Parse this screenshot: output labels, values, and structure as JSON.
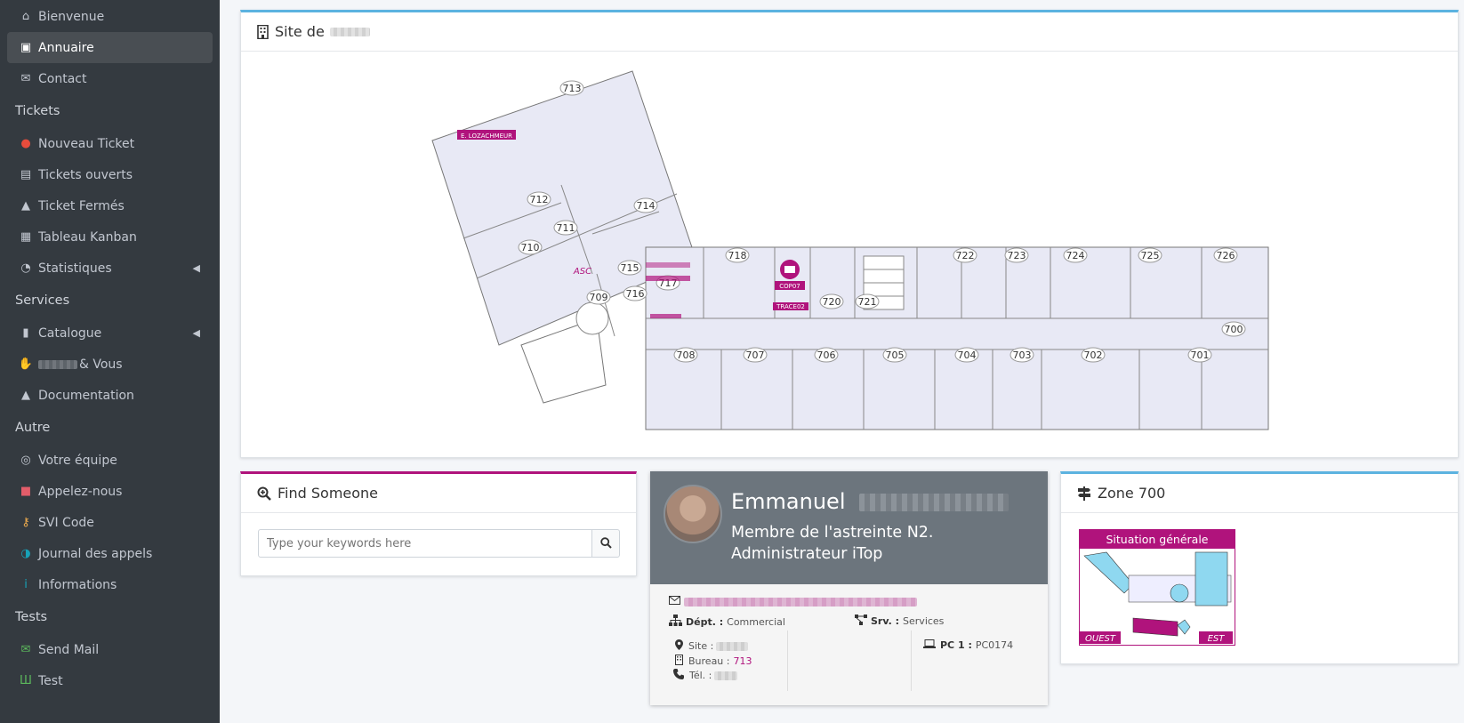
{
  "sidebar": {
    "items": [
      {
        "type": "item",
        "label": "Bienvenue",
        "icon": "home-icon"
      },
      {
        "type": "item",
        "label": "Annuaire",
        "icon": "address-card-icon",
        "active": true
      },
      {
        "type": "item",
        "label": "Contact",
        "icon": "envelope-icon"
      },
      {
        "type": "header",
        "label": "Tickets"
      },
      {
        "type": "item",
        "label": "Nouveau Ticket",
        "icon": "exclamation-circle-icon"
      },
      {
        "type": "item",
        "label": "Tickets ouverts",
        "icon": "clipboard-icon"
      },
      {
        "type": "item",
        "label": "Ticket Fermés",
        "icon": "lock-icon"
      },
      {
        "type": "item",
        "label": "Tableau Kanban",
        "icon": "table-icon"
      },
      {
        "type": "item",
        "label": "Statistiques",
        "icon": "tachometer-icon",
        "expandable": true
      },
      {
        "type": "header",
        "label": "Services"
      },
      {
        "type": "item",
        "label": "Catalogue",
        "icon": "book-icon",
        "expandable": true
      },
      {
        "type": "item",
        "label": "& Vous",
        "icon": "handshake-icon",
        "redacted_prefix": true
      },
      {
        "type": "item",
        "label": "Documentation",
        "icon": "graduation-cap-icon"
      },
      {
        "type": "header",
        "label": "Autre"
      },
      {
        "type": "item",
        "label": "Votre équipe",
        "icon": "users-icon"
      },
      {
        "type": "item",
        "label": "Appelez-nous",
        "icon": "phone-square-icon"
      },
      {
        "type": "item",
        "label": "SVI Code",
        "icon": "key-icon"
      },
      {
        "type": "item",
        "label": "Journal des appels",
        "icon": "headset-icon"
      },
      {
        "type": "item",
        "label": "Informations",
        "icon": "info-icon"
      },
      {
        "type": "header",
        "label": "Tests"
      },
      {
        "type": "item",
        "label": "Send Mail",
        "icon": "envelope-open-icon"
      },
      {
        "type": "item",
        "label": "Test",
        "icon": "vials-icon"
      }
    ]
  },
  "site_card": {
    "title": "Site de",
    "rooms": [
      "713",
      "712",
      "714",
      "711",
      "710",
      "ASC",
      "715",
      "716",
      "709",
      "717",
      "718",
      "720",
      "721",
      "722",
      "723",
      "724",
      "725",
      "726",
      "700",
      "708",
      "707",
      "706",
      "705",
      "704",
      "703",
      "702",
      "701"
    ],
    "labels": {
      "person_tag": "E. LOZACHMEUR",
      "printer_tag": "COP07",
      "device_tag": "TRACE02"
    }
  },
  "find": {
    "title": "Find Someone",
    "placeholder": "Type your keywords here"
  },
  "profile": {
    "first_name": "Emmanuel",
    "role_line1": "Membre de l'astreinte N2.",
    "role_line2": "Administrateur iTop",
    "dept_label": "Dépt. :",
    "dept_value": "Commercial",
    "srv_label": "Srv. :",
    "srv_value": "Services",
    "site_label": "Site :",
    "bureau_label": "Bureau :",
    "bureau_value": "713",
    "tel_label": "Tél. :",
    "pc_label": "PC 1 :",
    "pc_value": "PC0174"
  },
  "zone": {
    "title": "Zone 700",
    "banner": "Situation générale",
    "left_tag": "OUEST",
    "right_tag": "EST"
  },
  "colors": {
    "accent_pink": "#b0137c",
    "accent_blue": "#5cb3e0",
    "sidebar_bg": "#343a40",
    "profile_header": "#6c757d"
  }
}
